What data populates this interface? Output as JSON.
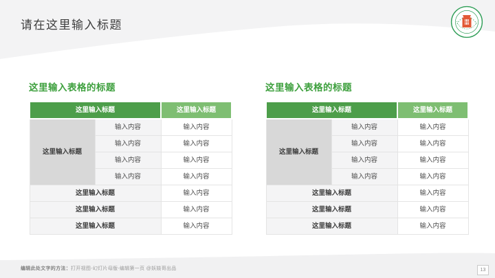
{
  "slide": {
    "title": "请在这里输入标题",
    "page_number": "13",
    "footer_label": "编辑此处文字的方法：",
    "footer_text": "打开视图-幻灯片母版-编辑第一页 @妖娆哥出品"
  },
  "logo": {
    "icon": "university-emblem-icon"
  },
  "colors": {
    "header_dark_green": "#4d9e4a",
    "header_light_green": "#7ebe72",
    "table_title_green": "#3ea03e",
    "group_cell_gray": "#d8d8d8",
    "light_cell_gray": "#f4f4f5",
    "band_gray": "#f3f3f4",
    "logo_ring_green": "#2f9e57",
    "logo_emblem_orange": "#e25a36"
  },
  "tables": [
    {
      "title": "这里输入表格的标题",
      "header": {
        "col_main": "这里输入标题",
        "col_right": "这里输入标题"
      },
      "group_label": "这里输入标题",
      "group_rows": [
        {
          "c1": "输入内容",
          "c2": "输入内容"
        },
        {
          "c1": "输入内容",
          "c2": "输入内容"
        },
        {
          "c1": "输入内容",
          "c2": "输入内容"
        },
        {
          "c1": "输入内容",
          "c2": "输入内容"
        }
      ],
      "label_rows": [
        {
          "label": "这里输入标题",
          "value": "输入内容"
        },
        {
          "label": "这里输入标题",
          "value": "输入内容"
        },
        {
          "label": "这里输入标题",
          "value": "输入内容"
        }
      ]
    },
    {
      "title": "这里输入表格的标题",
      "header": {
        "col_main": "这里输入标题",
        "col_right": "这里输入标题"
      },
      "group_label": "这里输入标题",
      "group_rows": [
        {
          "c1": "输入内容",
          "c2": "输入内容"
        },
        {
          "c1": "输入内容",
          "c2": "输入内容"
        },
        {
          "c1": "输入内容",
          "c2": "输入内容"
        },
        {
          "c1": "输入内容",
          "c2": "输入内容"
        }
      ],
      "label_rows": [
        {
          "label": "这里输入标题",
          "value": "输入内容"
        },
        {
          "label": "这里输入标题",
          "value": "输入内容"
        },
        {
          "label": "这里输入标题",
          "value": "输入内容"
        }
      ]
    }
  ]
}
